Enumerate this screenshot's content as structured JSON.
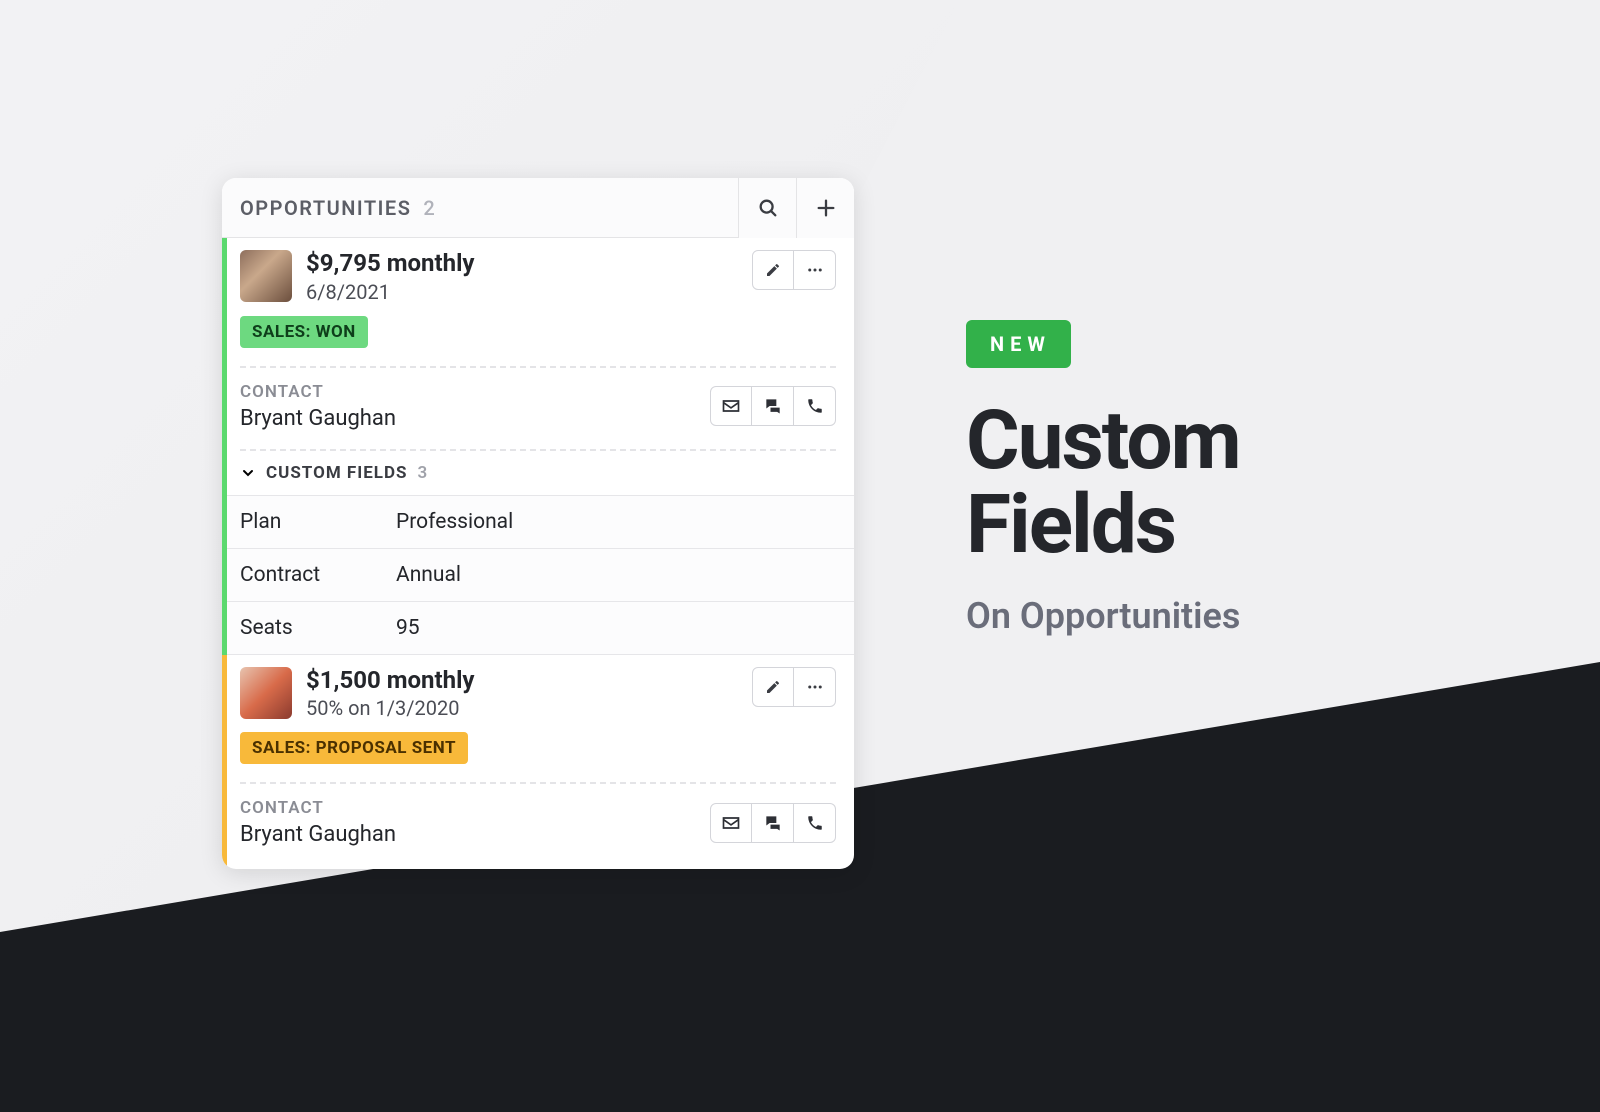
{
  "header": {
    "title": "OPPORTUNITIES",
    "count": "2"
  },
  "opportunities": [
    {
      "value": "$9,795 monthly",
      "date": "6/8/2021",
      "status": "SALES: WON",
      "contact_label": "CONTACT",
      "contact_name": "Bryant Gaughan",
      "custom_fields_label": "CUSTOM FIELDS",
      "custom_fields_count": "3",
      "fields": [
        {
          "key": "Plan",
          "value": "Professional"
        },
        {
          "key": "Contract",
          "value": "Annual"
        },
        {
          "key": "Seats",
          "value": "95"
        }
      ]
    },
    {
      "value": "$1,500 monthly",
      "date": "50% on 1/3/2020",
      "status": "SALES: PROPOSAL SENT",
      "contact_label": "CONTACT",
      "contact_name": "Bryant Gaughan"
    }
  ],
  "promo": {
    "badge": "NEW",
    "title_line1": "Custom",
    "title_line2": "Fields",
    "subtitle": "On Opportunities"
  }
}
